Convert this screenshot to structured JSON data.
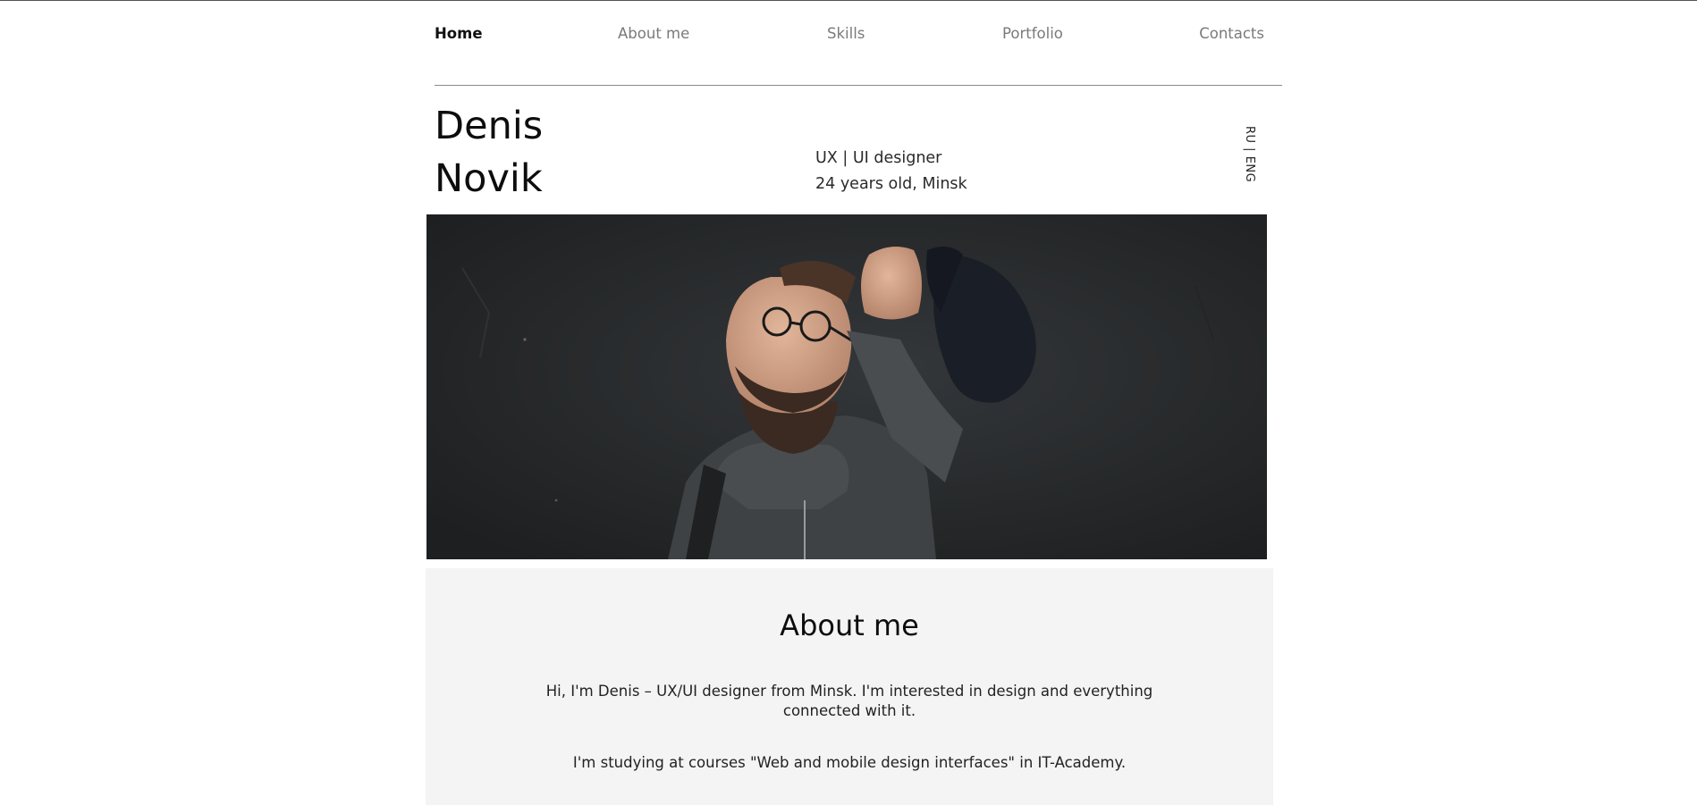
{
  "nav": {
    "items": [
      {
        "label": "Home",
        "active": true
      },
      {
        "label": "About me",
        "active": false
      },
      {
        "label": "Skills",
        "active": false
      },
      {
        "label": "Portfolio",
        "active": false
      },
      {
        "label": "Contacts",
        "active": false
      }
    ]
  },
  "header": {
    "first_name": "Denis",
    "last_name": "Novik",
    "role": "UX | UI designer",
    "bio_line": "24 years old, Minsk",
    "language_switch": "RU | ENG"
  },
  "hero": {
    "image": "portrait-photo"
  },
  "about": {
    "title": "About me",
    "paragraph_1": "Hi, I'm Denis – UX/UI designer from Minsk. I'm interested in design and everything connected with it.",
    "paragraph_2": "I'm studying at courses \"Web and mobile design interfaces\" in IT-Academy."
  },
  "colors": {
    "nav_active": "#111111",
    "nav_inactive": "#7a7a7a",
    "about_bg": "#f4f4f4",
    "hero_bg": "#27292a"
  }
}
